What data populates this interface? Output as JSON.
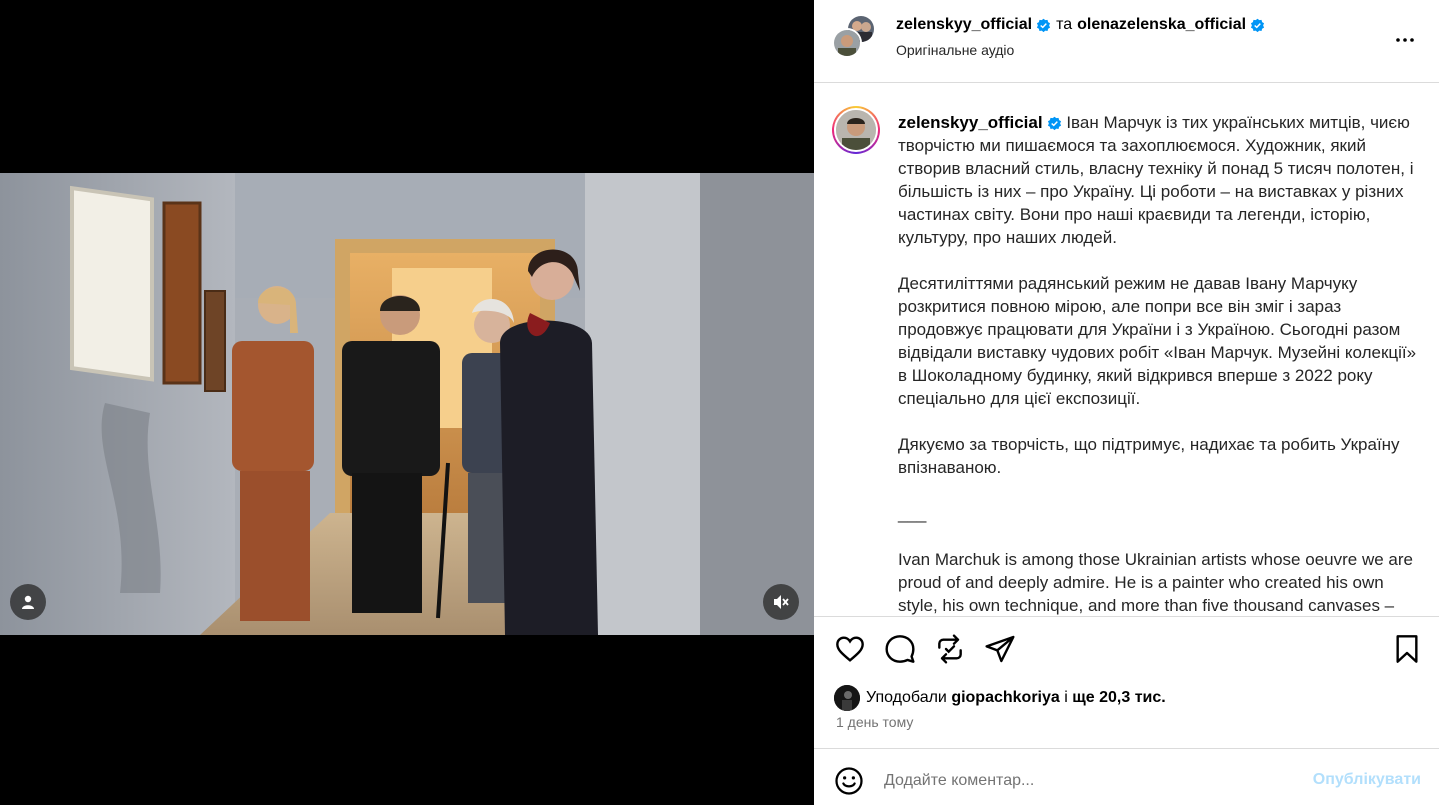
{
  "post": {
    "header": {
      "author1": "zelenskyy_official",
      "conjunction": "та",
      "author2": "olenazelenska_official",
      "audio": "Оригінальне аудіо"
    },
    "caption": {
      "username": "zelenskyy_official",
      "paragraphs": [
        "Іван Марчук із тих українських митців, чиєю творчістю ми пишаємося та захоплюємося. Художник, який створив власний стиль, власну техніку й понад 5 тисяч полотен, і більшість із них – про Україну. Ці роботи – на виставках у різних частинах світу. Вони про наші краєвиди та легенди, історію, культуру, про наших людей.",
        "Десятиліттями радянський режим не давав Івану Марчуку розкритися повною мірою, але попри все він зміг і зараз продовжує працювати для України і з Україною. Сьогодні разом відвідали виставку чудових робіт «Іван Марчук. Музейні колекції» в Шоколадному будинку, який відкрився вперше з 2022 року спеціально для цієї експозиції.",
        "Дякуємо за творчість, що підтримує, надихає та робить Україну впізнаваною.",
        "___",
        "Ivan Marchuk is among those Ukrainian artists whose oeuvre we are proud of and deeply admire. He is a painter who created his own style, his own technique, and more than five thousand canvases – most of them dedicated to Ukraine. These works are exhibited in different parts of the world. They are about our landscapes and"
      ]
    },
    "likes": {
      "prefix": "Уподобали",
      "user": "giopachkoriya",
      "middle": "і",
      "count": "ще 20,3 тис."
    },
    "time_ago": "1 день тому",
    "comment": {
      "placeholder": "Додайте коментар...",
      "publish": "Опублікувати"
    }
  },
  "icons": [
    "user-tag-icon",
    "muted-speaker-icon",
    "more-options-icon",
    "heart-icon",
    "comment-icon",
    "repost-icon",
    "share-icon",
    "bookmark-icon",
    "emoji-icon",
    "verified-badge-icon"
  ],
  "colors": {
    "verified": "#0095f6",
    "publish_disabled": "#b2dffc",
    "border": "#dbdbdb",
    "muted_text": "#737373"
  }
}
